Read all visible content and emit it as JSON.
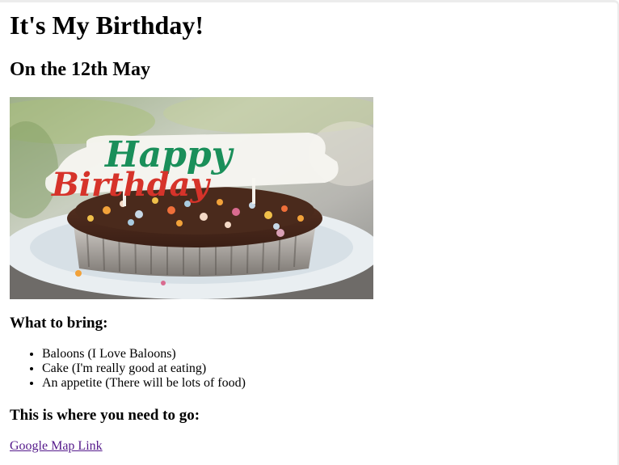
{
  "page": {
    "title": "It's My Birthday!",
    "date_heading": "On the 12th May",
    "bring_heading": "What to bring:",
    "bring_items": [
      "Baloons (I Love Baloons)",
      "Cake (I'm really good at eating)",
      "An appetite (There will be lots of food)"
    ],
    "location_heading": "This is where you need to go:",
    "map_link_text": "Google Map Link"
  },
  "image": {
    "alt": "Happy Birthday cake",
    "topper_text_line1": "Happy",
    "topper_text_line2": "Birthday"
  },
  "colors": {
    "link_visited": "#551a8b",
    "text": "#000000",
    "background": "#ffffff"
  }
}
